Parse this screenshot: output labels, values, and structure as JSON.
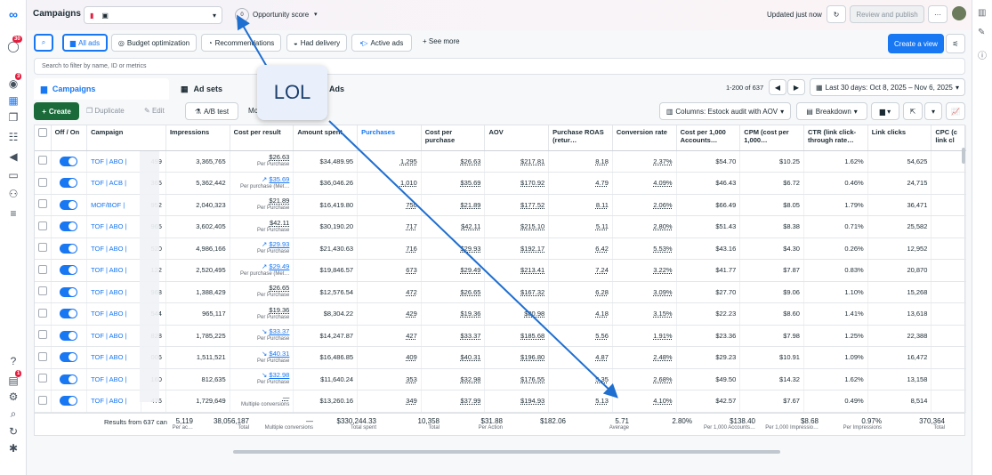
{
  "colors": {
    "accent": "#1877f2",
    "badge": "#e41e3f"
  },
  "topbar": {
    "logo_icon": "meta-logo-icon",
    "title": "Campaigns",
    "opportunity_label": "Opportunity score",
    "opportunity_value": "0",
    "updated_text": "Updated just now",
    "review_publish": "Review and publish",
    "more": "···"
  },
  "left_rail_badges": {
    "notifications": "30",
    "alerts": "3",
    "help": "1"
  },
  "filters": {
    "all_ads": "All ads",
    "budget_opt": "Budget optimization",
    "recommendations": "Recommendations",
    "had_delivery": "Had delivery",
    "active_ads": "Active ads",
    "see_more": "See more",
    "create_view": "Create a view",
    "search_placeholder": "Search to filter by name, ID or metrics"
  },
  "tabs": {
    "campaigns": "Campaigns",
    "adsets": "Ad sets",
    "ads": "Ads"
  },
  "pagination": {
    "range": "1-200 of 637",
    "date_range": "Last 30 days: Oct 8, 2025 – Nov 6, 2025"
  },
  "toolbar": {
    "create": "Create",
    "duplicate": "Duplicate",
    "edit": "Edit",
    "ab_test": "A/B test",
    "more": "Mo",
    "columns": "Columns: Estock audit with AOV",
    "breakdown": "Breakdown"
  },
  "headers": [
    "Off / On",
    "Campaign",
    "Impressions",
    "Cost per result",
    "Amount spent",
    "Purchases",
    "Cost per purchase",
    "AOV",
    "Purchase ROAS (retur…",
    "Conversion rate",
    "Cost per 1,000 Accounts…",
    "CPM (cost per 1,000…",
    "CTR (link click-through rate…",
    "Link clicks",
    "CPC (c link cl"
  ],
  "rows": [
    {
      "name": "TOF | ABO |",
      "impr": "3,365,765",
      "cpr": "$26.63",
      "cpr_sub": "Per Purchase",
      "trend": "",
      "spent": "$34,489.95",
      "purch": "1,295",
      "cpp": "$26.63",
      "aov": "$217.81",
      "roas": "8.18",
      "conv": "2.37%",
      "cpa": "$54.70",
      "cpm": "$10.25",
      "ctr": "1.62%",
      "clicks": "54,625"
    },
    {
      "name": "TOF | ACB |",
      "impr": "5,362,442",
      "cpr": "$35.69",
      "cpr_sub": "Per purchase (Met…",
      "trend": "up",
      "spent": "$36,046.26",
      "purch": "1,010",
      "cpp": "$35.69",
      "aov": "$170.92",
      "roas": "4.79",
      "conv": "4.09%",
      "cpa": "$46.43",
      "cpm": "$6.72",
      "ctr": "0.46%",
      "clicks": "24,715"
    },
    {
      "name": "MOF/BOF |",
      "impr": "2,040,323",
      "cpr": "$21.89",
      "cpr_sub": "Per Purchase",
      "trend": "",
      "spent": "$16,419.80",
      "purch": "750",
      "cpp": "$21.89",
      "aov": "$177.52",
      "roas": "8.11",
      "conv": "2.06%",
      "cpa": "$66.49",
      "cpm": "$8.05",
      "ctr": "1.79%",
      "clicks": "36,471"
    },
    {
      "name": "TOF | ABO |",
      "impr": "3,602,405",
      "cpr": "$42.11",
      "cpr_sub": "Per Purchase",
      "trend": "",
      "spent": "$30,190.20",
      "purch": "717",
      "cpp": "$42.11",
      "aov": "$215.10",
      "roas": "5.11",
      "conv": "2.80%",
      "cpa": "$51.43",
      "cpm": "$8.38",
      "ctr": "0.71%",
      "clicks": "25,582"
    },
    {
      "name": "TOF | ABO |",
      "impr": "4,986,166",
      "cpr": "$29.93",
      "cpr_sub": "Per Purchase",
      "trend": "up",
      "spent": "$21,430.63",
      "purch": "716",
      "cpp": "$29.93",
      "aov": "$192.17",
      "roas": "6.42",
      "conv": "5.53%",
      "cpa": "$43.16",
      "cpm": "$4.30",
      "ctr": "0.26%",
      "clicks": "12,952"
    },
    {
      "name": "TOF | ABO |",
      "impr": "2,520,495",
      "cpr": "$29.49",
      "cpr_sub": "Per purchase (Met…",
      "trend": "up",
      "spent": "$19,846.57",
      "purch": "673",
      "cpp": "$29.49",
      "aov": "$213.41",
      "roas": "7.24",
      "conv": "3.22%",
      "cpa": "$41.77",
      "cpm": "$7.87",
      "ctr": "0.83%",
      "clicks": "20,870"
    },
    {
      "name": "TOF | ABO |",
      "impr": "1,388,429",
      "cpr": "$26.65",
      "cpr_sub": "Per Purchase",
      "trend": "",
      "spent": "$12,576.54",
      "purch": "472",
      "cpp": "$26.65",
      "aov": "$167.32",
      "roas": "6.28",
      "conv": "3.09%",
      "cpa": "$27.70",
      "cpm": "$9.06",
      "ctr": "1.10%",
      "clicks": "15,268"
    },
    {
      "name": "TOF | ABO |",
      "impr": "965,117",
      "cpr": "$19.36",
      "cpr_sub": "Per Purchase",
      "trend": "",
      "spent": "$8,304.22",
      "purch": "429",
      "cpp": "$19.36",
      "aov": "$80.98",
      "roas": "4.18",
      "conv": "3.15%",
      "cpa": "$22.23",
      "cpm": "$8.60",
      "ctr": "1.41%",
      "clicks": "13,618"
    },
    {
      "name": "TOF | ABO |",
      "impr": "1,785,225",
      "cpr": "$33.37",
      "cpr_sub": "Per Purchase",
      "trend": "down",
      "spent": "$14,247.87",
      "purch": "427",
      "cpp": "$33.37",
      "aov": "$185.68",
      "roas": "5.56",
      "conv": "1.91%",
      "cpa": "$23.36",
      "cpm": "$7.98",
      "ctr": "1.25%",
      "clicks": "22,388"
    },
    {
      "name": "TOF | ABO |",
      "impr": "1,511,521",
      "cpr": "$40.31",
      "cpr_sub": "Per Purchase",
      "trend": "down",
      "spent": "$16,486.85",
      "purch": "409",
      "cpp": "$40.31",
      "aov": "$196.80",
      "roas": "4.87",
      "conv": "2.48%",
      "cpa": "$29.23",
      "cpm": "$10.91",
      "ctr": "1.09%",
      "clicks": "16,472"
    },
    {
      "name": "TOF | ABO |",
      "impr": "812,635",
      "cpr": "$32.98",
      "cpr_sub": "Per Purchase",
      "trend": "down",
      "spent": "$11,640.24",
      "purch": "353",
      "cpp": "$32.98",
      "aov": "$176.55",
      "roas": "5.35",
      "conv": "2.68%",
      "cpa": "$49.50",
      "cpm": "$14.32",
      "ctr": "1.62%",
      "clicks": "13,158"
    },
    {
      "name": "TOF | ABO |",
      "impr": "1,729,649",
      "cpr": "—",
      "cpr_sub": "Multiple conversions",
      "trend": "",
      "spent": "$13,260.16",
      "purch": "349",
      "cpp": "$37.99",
      "aov": "$194.93",
      "roas": "5.13",
      "conv": "4.10%",
      "cpa": "$42.57",
      "cpm": "$7.67",
      "ctr": "0.49%",
      "clicks": "8,514"
    }
  ],
  "row_id_fragments": [
    "499",
    "365",
    "952",
    "965",
    "520",
    "122",
    "968",
    "544",
    "828",
    "006",
    "160",
    "476"
  ],
  "totals": {
    "label": "Results from 637 can",
    "id_frag": "5,119",
    "id_sub": "Per ac…",
    "impr": "38,056,187",
    "impr_sub": "Total",
    "cpr": "—",
    "cpr_sub": "Multiple conversions",
    "spent": "$330,244.33",
    "spent_sub": "Total spent",
    "purch": "10,358",
    "purch_sub": "Total",
    "cpp": "$31.88",
    "cpp_sub": "Per Action",
    "aov": "$182.06",
    "roas": "5.71",
    "roas_sub": "Average",
    "conv": "2.80%",
    "cpa": "$138.40",
    "cpa_sub": "Per 1,000 Accounts…",
    "cpm": "$8.68",
    "cpm_sub": "Per 1,000 Impressio…",
    "ctr": "0.97%",
    "ctr_sub": "Per Impressions",
    "clicks": "370,364",
    "clicks_sub": "Total"
  },
  "annotation": {
    "text": "LOL"
  }
}
